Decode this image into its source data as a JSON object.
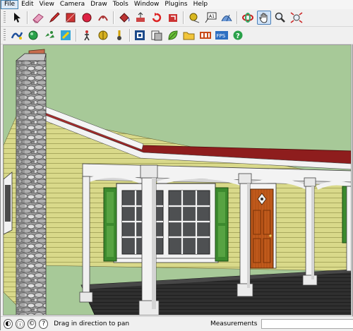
{
  "menu": [
    "File",
    "Edit",
    "View",
    "Camera",
    "Draw",
    "Tools",
    "Window",
    "Plugins",
    "Help"
  ],
  "toolbar1": [
    "select-arrow",
    "eraser",
    "pencil-line",
    "rectangle",
    "circle",
    "arc",
    "paint-bucket",
    "push-pull",
    "follow-me",
    "rotate",
    "offset",
    "tape-measure",
    "text-label",
    "protractor",
    "orbit",
    "pan-hand",
    "zoom-magnifier",
    "zoom-extents"
  ],
  "toolbar2": [
    "sandbox",
    "ruby-console",
    "components",
    "styles",
    "walk-person",
    "position-camera",
    "model-info",
    "outliner",
    "materials",
    "open-folder",
    "film-animation",
    "fps-counter",
    "help-question"
  ],
  "statusbar": {
    "message": "Drag in direction to pan",
    "measurements_label": "Measurements",
    "measurements_value": ""
  }
}
